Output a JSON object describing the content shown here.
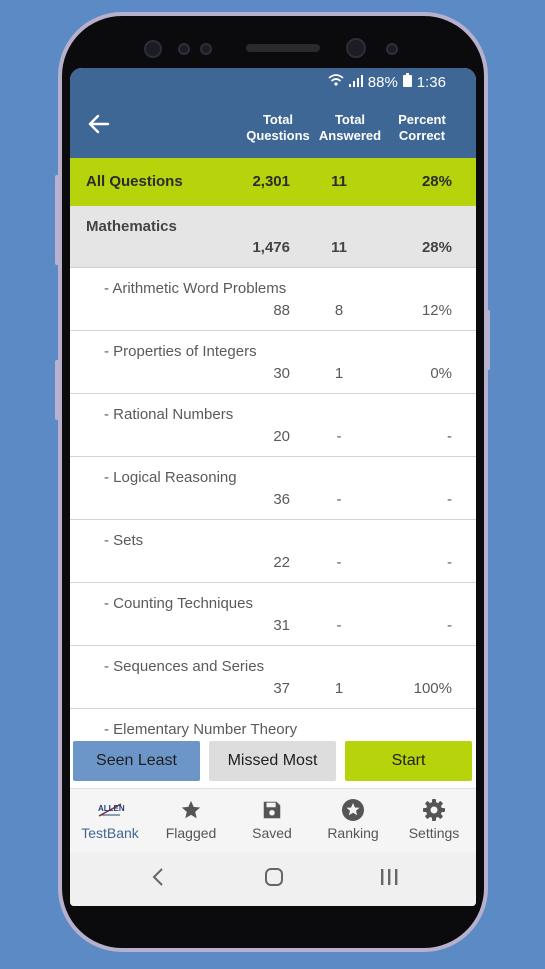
{
  "status": {
    "battery": "88%",
    "time": "1:36"
  },
  "header": {
    "col_total_questions": [
      "Total",
      "Questions"
    ],
    "col_total_answered": [
      "Total",
      "Answered"
    ],
    "col_percent_correct": [
      "Percent",
      "Correct"
    ]
  },
  "all_questions": {
    "label": "All Questions",
    "total": "2,301",
    "answered": "11",
    "percent": "28%"
  },
  "category": {
    "label": "Mathematics",
    "total": "1,476",
    "answered": "11",
    "percent": "28%"
  },
  "topics": [
    {
      "label": "- Arithmetic Word Problems",
      "total": "88",
      "answered": "8",
      "percent": "12%"
    },
    {
      "label": "- Properties of Integers",
      "total": "30",
      "answered": "1",
      "percent": "0%"
    },
    {
      "label": "- Rational Numbers",
      "total": "20",
      "answered": "-",
      "percent": "-"
    },
    {
      "label": "- Logical Reasoning",
      "total": "36",
      "answered": "-",
      "percent": "-"
    },
    {
      "label": "- Sets",
      "total": "22",
      "answered": "-",
      "percent": "-"
    },
    {
      "label": "- Counting Techniques",
      "total": "31",
      "answered": "-",
      "percent": "-"
    },
    {
      "label": "- Sequences and Series",
      "total": "37",
      "answered": "1",
      "percent": "100%"
    },
    {
      "label": "- Elementary Number Theory",
      "total": "",
      "answered": "",
      "percent": ""
    }
  ],
  "buttons": {
    "seen_least": "Seen Least",
    "missed_most": "Missed Most",
    "start": "Start"
  },
  "tabs": [
    {
      "label": "TestBank",
      "icon": "allen-logo-icon",
      "logo_text": "ALLEN"
    },
    {
      "label": "Flagged",
      "icon": "star-icon"
    },
    {
      "label": "Saved",
      "icon": "save-icon"
    },
    {
      "label": "Ranking",
      "icon": "ranking-star-icon"
    },
    {
      "label": "Settings",
      "icon": "gear-icon"
    }
  ],
  "colors": {
    "header_bg": "#3f6795",
    "accent_green": "#b6d30c",
    "seen_least_bg": "#6d96c8",
    "missed_most_bg": "#dddddd",
    "tab_active": "#3f6795"
  }
}
